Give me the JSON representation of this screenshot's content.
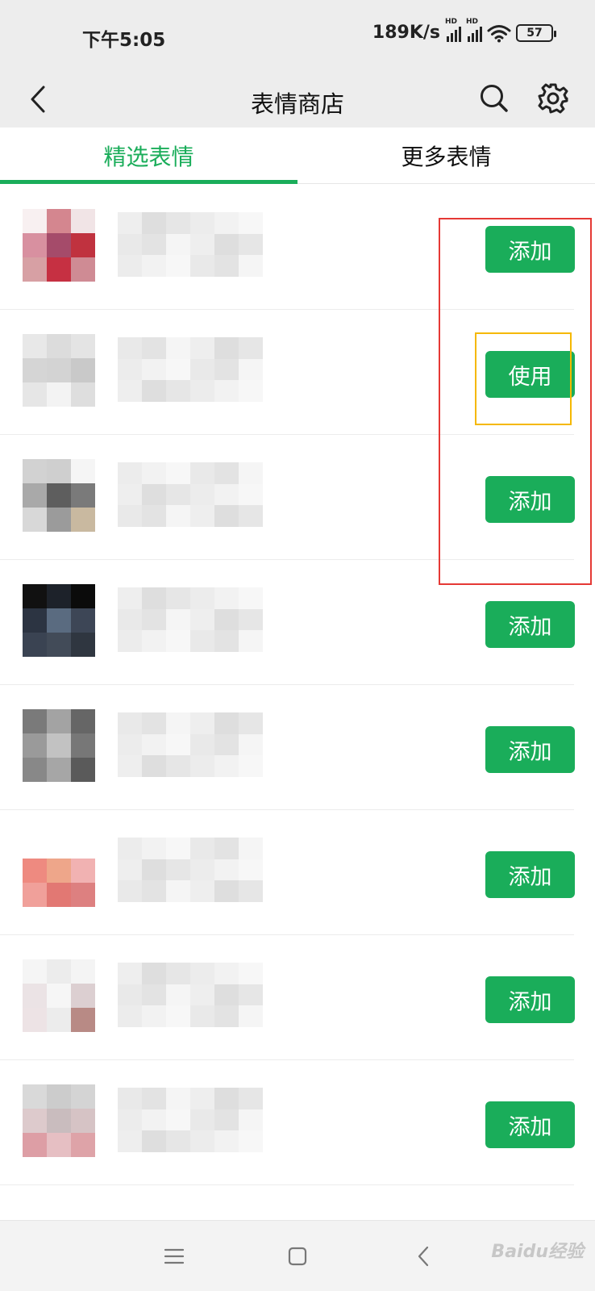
{
  "status_bar": {
    "time": "下午5:05",
    "network_speed": "189K/s",
    "battery_level": "57",
    "signal_label": "HD"
  },
  "nav": {
    "title": "表情商店"
  },
  "tabs": [
    {
      "label": "精选表情",
      "active": true
    },
    {
      "label": "更多表情",
      "active": false
    }
  ],
  "items": [
    {
      "button": "添加",
      "palette": [
        "#f8f0f1",
        "#d4868f",
        "#f1e4e6",
        "#d890a0",
        "#a54b6a",
        "#c0323f",
        "#d7a0a4",
        "#c63042",
        "#cf8b94"
      ]
    },
    {
      "button": "使用",
      "palette": [
        "#e8e8e8",
        "#dcdcdc",
        "#e4e4e4",
        "#d5d5d5",
        "#d3d3d3",
        "#c9c9c9",
        "#e6e6e6",
        "#f3f3f3",
        "#dedede"
      ]
    },
    {
      "button": "添加",
      "palette": [
        "#d2d2d2",
        "#cfcfcf",
        "#f5f5f5",
        "#a9a9a9",
        "#5e5e5e",
        "#7a7a7a",
        "#d8d8d8",
        "#9b9b9b",
        "#c9b9a0"
      ]
    },
    {
      "button": "添加",
      "palette": [
        "#111111",
        "#1d222a",
        "#0b0b0b",
        "#2c3442",
        "#5a6b80",
        "#3d4656",
        "#3a4352",
        "#424b58",
        "#2f3640"
      ]
    },
    {
      "button": "添加",
      "palette": [
        "#7a7a7a",
        "#a3a3a3",
        "#666666",
        "#9a9a9a",
        "#c2c2c2",
        "#777777",
        "#888888",
        "#a6a6a6",
        "#5a5a5a"
      ]
    },
    {
      "button": "添加",
      "palette": [
        "#ffffff",
        "#ffffff",
        "#ffffff",
        "#ee8a80",
        "#eea68a",
        "#f1b2b2",
        "#f0a09a",
        "#e27873",
        "#dd8080"
      ]
    },
    {
      "button": "添加",
      "palette": [
        "#f5f5f5",
        "#ececec",
        "#f4f4f4",
        "#ebe3e5",
        "#f6f6f6",
        "#dccfd1",
        "#ede3e5",
        "#ececec",
        "#b88a85"
      ]
    },
    {
      "button": "添加",
      "palette": [
        "#d9d9d9",
        "#cccccc",
        "#d4d4d4",
        "#ddcacc",
        "#c9bcbe",
        "#d6c3c5",
        "#dd9ea5",
        "#e6bfc3",
        "#dea3a8"
      ]
    }
  ],
  "system_nav": {
    "watermark": "Baidu经验"
  },
  "colors": {
    "accent": "#1aad5a",
    "highlight_red": "#e53935",
    "highlight_yellow": "#f5b800"
  }
}
